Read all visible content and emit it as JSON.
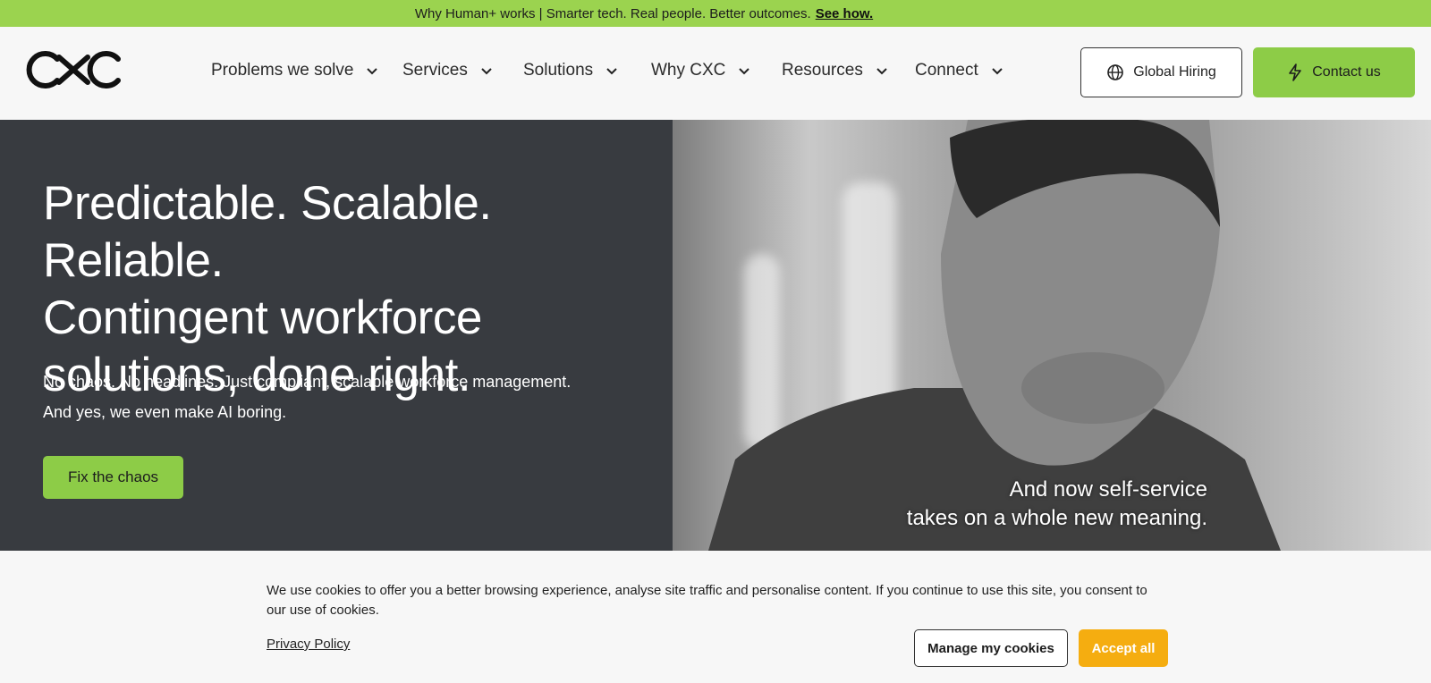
{
  "promo": {
    "text": "Why Human+ works | Smarter tech. Real people. Better outcomes.",
    "link": "See how."
  },
  "header": {
    "logo": "CXC",
    "nav": [
      {
        "label": "Problems we solve",
        "icon": "chevron-down-icon"
      },
      {
        "label": "Services",
        "icon": "chevron-down-icon"
      },
      {
        "label": "Solutions",
        "icon": "chevron-down-icon"
      },
      {
        "label": "Why CXC",
        "icon": "chevron-down-icon"
      },
      {
        "label": "Resources",
        "icon": "chevron-down-icon"
      },
      {
        "label": "Connect",
        "icon": "chevron-down-icon"
      }
    ],
    "global_hiring": {
      "label": "Global Hiring",
      "icon": "globe-icon"
    },
    "contact": {
      "label": "Contact us",
      "icon": "lightning-icon"
    }
  },
  "hero": {
    "title_lines": [
      "Predictable. Scalable. Reliable.",
      "Contingent workforce",
      "solutions, done right."
    ],
    "sub_lines": [
      "No chaos. No headlines. Just compliant, scalable workforce management.",
      "And yes, we even make AI boring."
    ],
    "cta": "Fix the chaos",
    "caption_lines": [
      "And now self-service",
      "takes on a whole new meaning."
    ]
  },
  "cookie": {
    "text": "We use cookies to offer you a better browsing experience, analyse site traffic and personalise content. If you continue to use this site, you consent to our use of cookies.",
    "privacy_link": "Privacy Policy",
    "manage": "Manage my cookies",
    "accept": "Accept all"
  },
  "colors": {
    "accent_green": "#8dcc47",
    "promo_green": "#9bd34f",
    "hero_dark": "#383b40",
    "accept_orange": "#f5ad10"
  }
}
